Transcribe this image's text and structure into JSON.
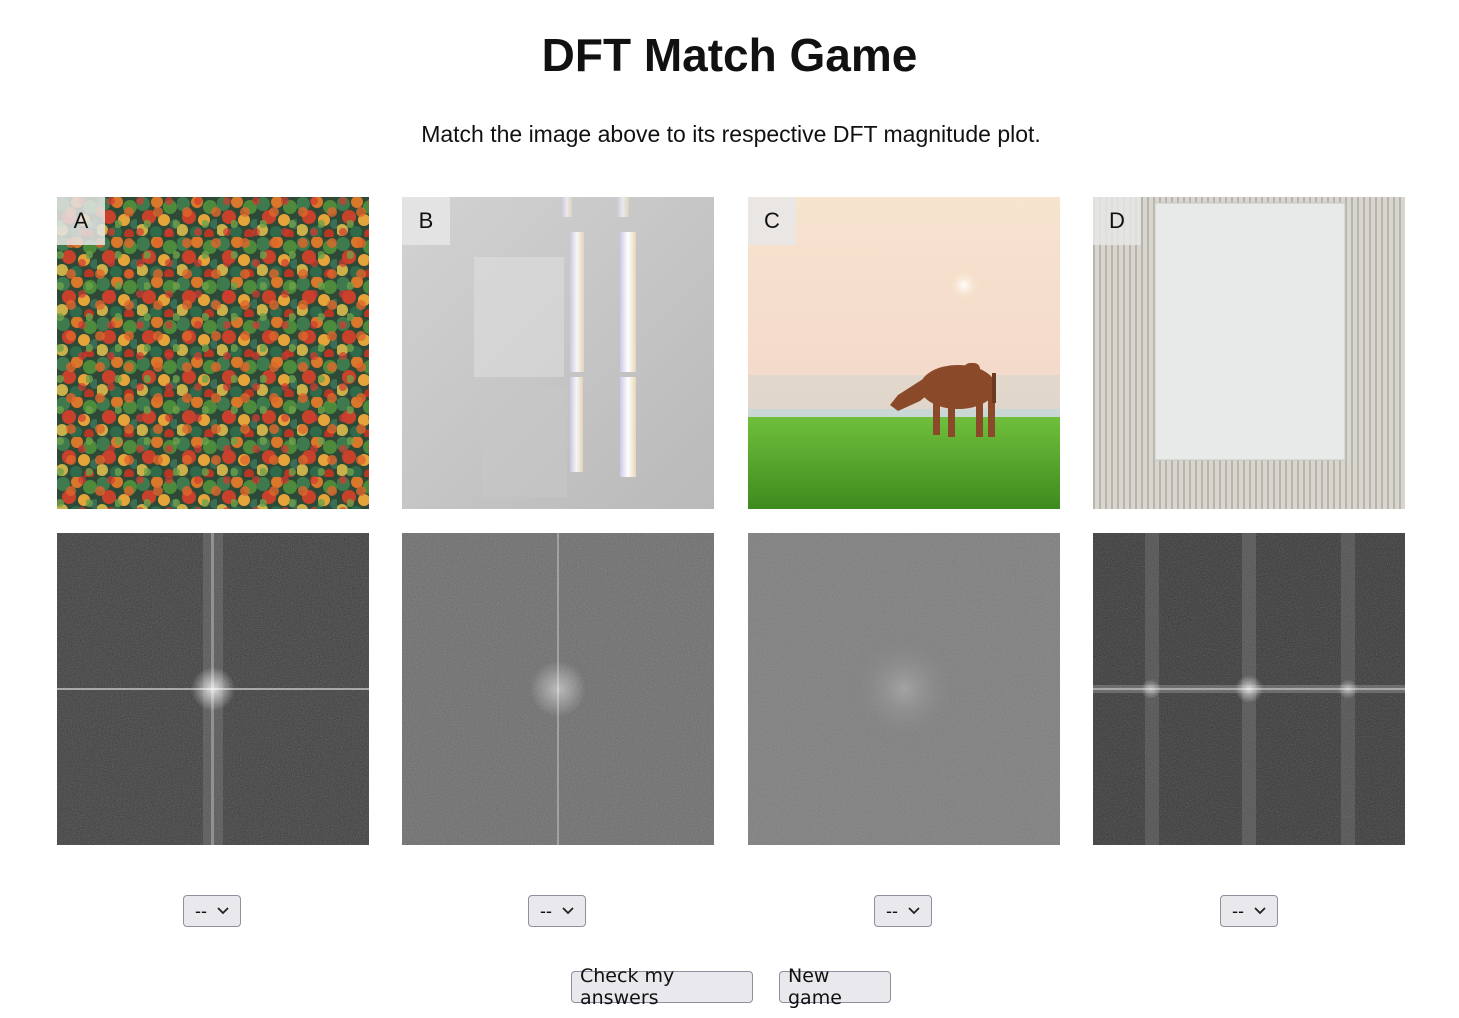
{
  "title": "DFT Match Game",
  "instructions": "Match the image above to its respective DFT magnitude plot.",
  "images": [
    {
      "label": "A",
      "subject": "aerial view of autumn forest canopy"
    },
    {
      "label": "B",
      "subject": "light and shadow on a grey wall"
    },
    {
      "label": "C",
      "subject": "cow grazing in a green field at sunrise"
    },
    {
      "label": "D",
      "subject": "blank white canvas on ribbed wall"
    }
  ],
  "answers": [
    {
      "selected": "--"
    },
    {
      "selected": "--"
    },
    {
      "selected": "--"
    },
    {
      "selected": "--"
    }
  ],
  "buttons": {
    "check": "Check my answers",
    "new_game": "New game"
  }
}
